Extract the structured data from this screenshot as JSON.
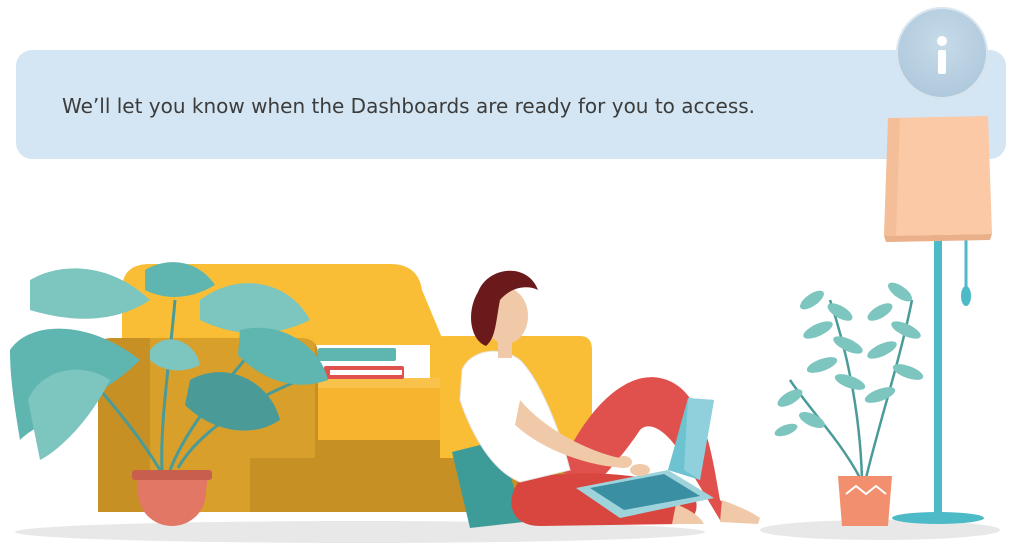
{
  "banner": {
    "message": "We’ll let you know when the Dashboards are ready for you to access."
  },
  "info_badge": {
    "icon": "info-icon",
    "color": "#b2cbde"
  },
  "illustration": {
    "icon": "woman-with-laptop-illustration",
    "colors": {
      "sofa": "#f9be35",
      "sofa_shadow": "#c79025",
      "leaves": "#5fb5b0",
      "pants": "#e0514d",
      "hair": "#6b1a1c",
      "lamp_shade": "#fbc9a6",
      "lamp_pole": "#4dbac8",
      "floor": "#e8e8e8"
    }
  }
}
